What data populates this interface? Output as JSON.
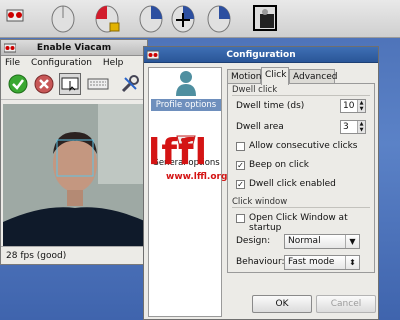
{
  "viacam": {
    "title": "Enable Viacam",
    "menu": {
      "file": "File",
      "configuration": "Configuration",
      "help": "Help"
    },
    "status": "28 fps (good)"
  },
  "config": {
    "title": "Configuration",
    "sidebar": {
      "profile_options": "Profile options",
      "general_options": "General options"
    },
    "tabs": {
      "motion": "Motion",
      "click": "Click",
      "advanced": "Advanced"
    },
    "dwell_click": {
      "heading": "Dwell click",
      "dwell_time_label": "Dwell time (ds)",
      "dwell_time_value": "10",
      "dwell_area_label": "Dwell area",
      "dwell_area_value": "3",
      "allow_consecutive": "Allow consecutive clicks",
      "allow_consecutive_checked": false,
      "beep_on_click": "Beep on click",
      "beep_on_click_checked": true,
      "dwell_enabled": "Dwell click enabled",
      "dwell_enabled_checked": true
    },
    "click_window": {
      "heading": "Click window",
      "open_at_startup": "Open Click Window at startup",
      "open_at_startup_checked": false,
      "design_label": "Design:",
      "design_value": "Normal",
      "behaviour_label": "Behaviour:",
      "behaviour_value": "Fast mode"
    },
    "buttons": {
      "ok": "OK",
      "cancel": "Cancel"
    }
  },
  "watermark": {
    "text": "lffl",
    "url": "www.lffl.org"
  },
  "colors": {
    "title_active": "#2a5698",
    "watermark": "#d41414"
  }
}
